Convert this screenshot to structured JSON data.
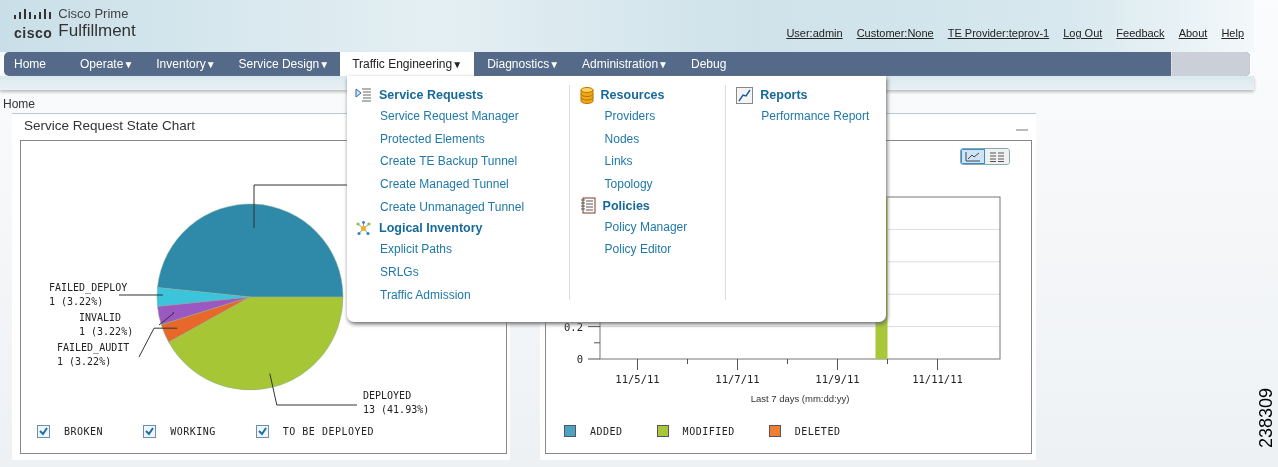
{
  "app": {
    "brand": "cisco",
    "product_line": "Cisco Prime",
    "product": "Fulfillment"
  },
  "header_links": [
    "User:admin",
    "Customer:None",
    "TE Provider:teprov-1",
    "Log Out",
    "Feedback",
    "About",
    "Help"
  ],
  "nav": [
    {
      "label": "Home",
      "dropdown": false,
      "selected": false
    },
    {
      "label": "Operate",
      "dropdown": true,
      "selected": false
    },
    {
      "label": "Inventory",
      "dropdown": true,
      "selected": false
    },
    {
      "label": "Service Design",
      "dropdown": true,
      "selected": false
    },
    {
      "label": "Traffic Engineering",
      "dropdown": true,
      "selected": true
    },
    {
      "label": "Diagnostics",
      "dropdown": true,
      "selected": false
    },
    {
      "label": "Administration",
      "dropdown": true,
      "selected": false
    },
    {
      "label": "Debug",
      "dropdown": false,
      "selected": false
    }
  ],
  "nav_caret": "▼",
  "menu": {
    "columns": [
      {
        "groups": [
          {
            "title": "Service Requests",
            "items": [
              "Service Request Manager",
              "Protected Elements",
              "Create TE Backup Tunnel",
              "Create Managed Tunnel",
              "Create Unmanaged Tunnel"
            ]
          },
          {
            "title": "Logical Inventory",
            "items": [
              "Explicit Paths",
              "SRLGs",
              "Traffic Admission"
            ]
          }
        ]
      },
      {
        "groups": [
          {
            "title": "Resources",
            "items": [
              "Providers",
              "Nodes",
              "Links",
              "Topology"
            ]
          },
          {
            "title": "Policies",
            "items": [
              "Policy Manager",
              "Policy Editor"
            ]
          }
        ]
      },
      {
        "groups": [
          {
            "title": "Reports",
            "items": [
              "Performance Report"
            ]
          }
        ]
      }
    ]
  },
  "breadcrumb": "Home",
  "left_panel": {
    "title": "Service Request State Chart",
    "chart_data": {
      "type": "pie",
      "categories": [
        null,
        "FAILED_DEPLOY",
        "INVALID",
        "FAILED_AUDIT",
        "DEPLOYED"
      ],
      "values": [
        15,
        1,
        1,
        1,
        13
      ],
      "value_labels": [
        null,
        "1 (3.22%)",
        "1 (3.22%)",
        "1 (3.22%)",
        "13 (41.93%)"
      ],
      "colors": [
        "#2e8aa8",
        "#3cc4dc",
        "#9a58c0",
        "#e8682a",
        "#a6c636"
      ]
    },
    "filters": [
      {
        "label": "BROKEN",
        "checked": true
      },
      {
        "label": "WORKING",
        "checked": true
      },
      {
        "label": "TO BE DEPLOYED",
        "checked": true
      }
    ]
  },
  "right_panel": {
    "view_toggle": [
      {
        "kind": "chart",
        "selected": true
      },
      {
        "kind": "table",
        "selected": false
      }
    ],
    "chart_data": {
      "type": "bar",
      "xlabel": "Last 7  days (mm:dd:yy)",
      "ylim": [
        0,
        1
      ],
      "categories": [
        "11/5/11",
        null,
        "11/7/11",
        null,
        "11/9/11",
        null,
        "11/11/11"
      ],
      "yticks": [
        0,
        0.2
      ],
      "series": [
        {
          "name": "ADDED",
          "color": "#4aa3c0",
          "values": [
            0,
            0,
            0,
            0,
            0,
            0,
            0
          ]
        },
        {
          "name": "MODIFIED",
          "color": "#a8c83a",
          "values": [
            null,
            null,
            null,
            null,
            null,
            null,
            null
          ]
        },
        {
          "name": "DELETED",
          "color": "#f08030",
          "values": [
            0,
            0,
            0,
            0,
            0,
            0,
            0
          ]
        }
      ]
    },
    "covered_bar": true
  },
  "figure_number": "238309"
}
